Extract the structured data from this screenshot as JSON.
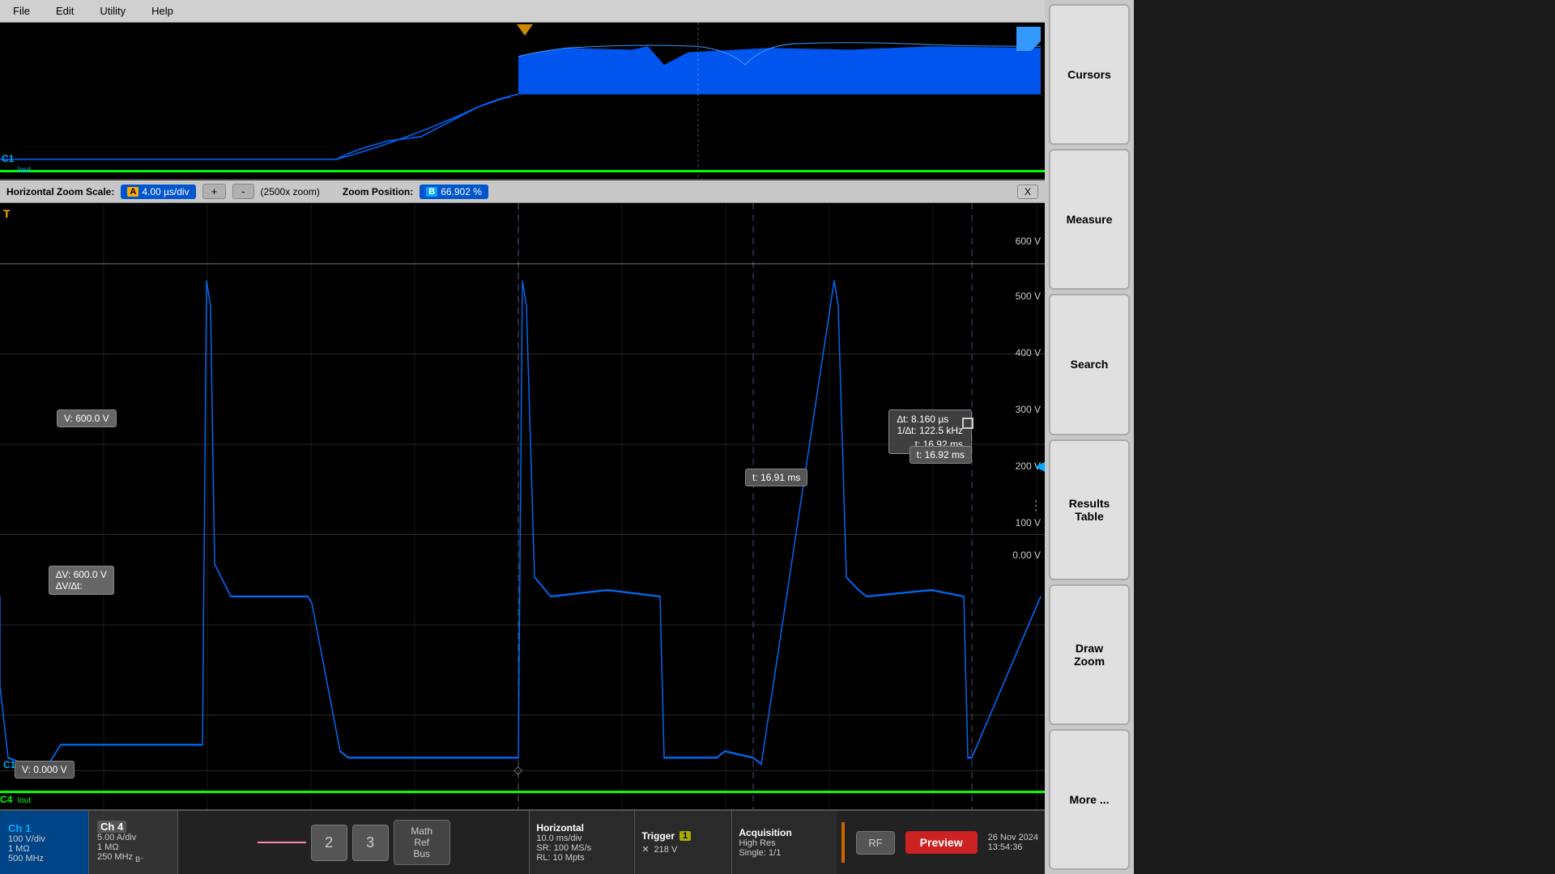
{
  "menu": {
    "items": [
      "File",
      "Edit",
      "Utility",
      "Help"
    ]
  },
  "overview": {
    "trigger_position_pct": 49.8,
    "ch_label": "C1"
  },
  "zoom_bar": {
    "label": "Horizontal Zoom Scale:",
    "channel_letter": "A",
    "scale_value": "4.00 µs/div",
    "plus": "+",
    "minus": "-",
    "multiplier": "(2500x zoom)",
    "pos_label": "Zoom Position:",
    "pos_letter": "B",
    "pos_value": "66.902 %",
    "x_btn": "X"
  },
  "waveform": {
    "trigger_marker": "T",
    "volt_labels": [
      "600 V",
      "500 V",
      "400 V",
      "300 V",
      "200 V",
      "100 V",
      "0.00 V"
    ],
    "cursor1": {
      "v_label": "V:  600.0 V",
      "t_label": "t:   16.91 ms"
    },
    "cursor2": {
      "t_label": "t:   16.92 ms"
    },
    "delta_box": {
      "dt": "∆t:   8.160 µs",
      "inv_dt": "1/∆t:  122.5 kHz",
      "t": "t:   16.92 ms"
    },
    "delta_v_box": {
      "dv": "∆V:    600.0 V",
      "dvdt": "∆V/∆t:"
    }
  },
  "bottom_bar": {
    "ch1": {
      "name": "Ch 1",
      "volts_div": "100 V/div",
      "impedance": "1 MΩ",
      "bandwidth": "500 MHz"
    },
    "ch4": {
      "name": "Ch 4",
      "volts_div": "5.00 A/div",
      "impedance": "1 MΩ",
      "bandwidth": "250 MHz",
      "suffix": "B⁻"
    },
    "btn2": "2",
    "btn3": "3",
    "math_ref_bus": "Math\nRef\nBus",
    "horizontal": {
      "title": "Horizontal",
      "time_div": "10.0 ms/div",
      "sr": "SR: 100 MS/s",
      "rl": "RL: 10 Mpts"
    },
    "trigger": {
      "title": "Trigger",
      "channel": "1",
      "mode": "✕",
      "voltage": "218 V"
    },
    "acquisition": {
      "title": "Acquisition",
      "mode": "High Res",
      "detail": "Single: 1/1"
    },
    "rf": "RF",
    "preview": "Preview",
    "date": "26 Nov 2024",
    "time": "13:54:36"
  },
  "right_panel": {
    "cursors": "Cursors",
    "measure": "Measure",
    "search": "Search",
    "results_table": "Results\nTable",
    "draw_zoom": "Draw\nZoom",
    "more": "More ..."
  }
}
